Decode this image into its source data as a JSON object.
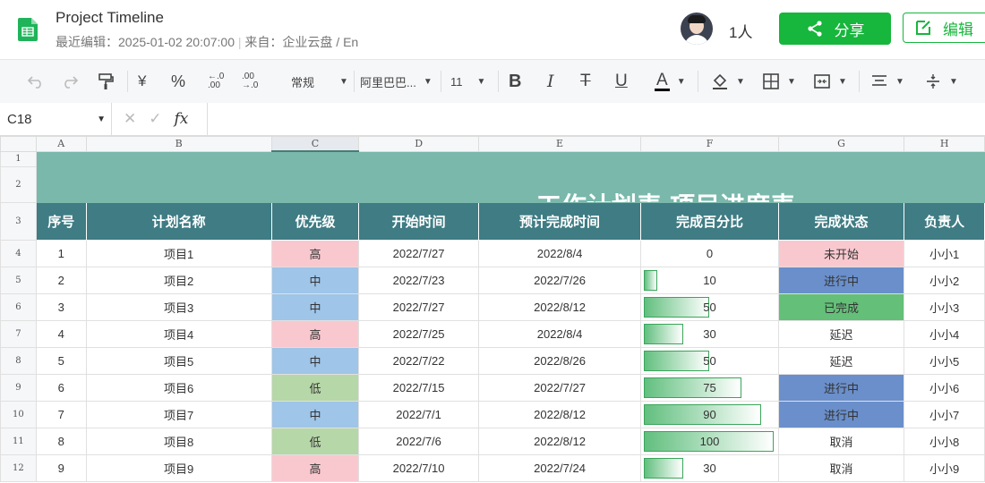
{
  "header": {
    "title": "Project Timeline",
    "meta_edited": "最近编辑：2025-01-02 20:07:00",
    "meta_source": "来自：企业云盘 / En",
    "people_count": "1人",
    "share_label": "分享",
    "edit_label": "编辑"
  },
  "toolbar": {
    "currency": "¥",
    "percent": "%",
    "dec_increase": "←.0 .00",
    "dec_decrease": ".00 →.0",
    "number_format": "常规",
    "font_family": "阿里巴巴...",
    "font_size": "11",
    "bold": "B",
    "italic": "I",
    "strike": "T",
    "underline": "U",
    "font_color": "A"
  },
  "formula_bar": {
    "cell_ref": "C18",
    "fx": "fx"
  },
  "columns": [
    "A",
    "B",
    "C",
    "D",
    "E",
    "F",
    "G",
    "H"
  ],
  "row_numbers": [
    "1",
    "2",
    "3",
    "4",
    "5",
    "6",
    "7",
    "8",
    "9",
    "10",
    "11",
    "12"
  ],
  "sheet": {
    "title": "工作计划表-项目进度表",
    "headers": [
      "序号",
      "计划名称",
      "优先级",
      "开始时间",
      "预计完成时间",
      "完成百分比",
      "完成状态",
      "负责人"
    ],
    "rows": [
      {
        "no": "1",
        "name": "项目1",
        "priority": "高",
        "priority_level": "high",
        "start": "2022/7/27",
        "end": "2022/8/4",
        "pct": "0",
        "pct_value": 0,
        "status": "未开始",
        "status_type": "notstart",
        "owner": "小小1"
      },
      {
        "no": "2",
        "name": "项目2",
        "priority": "中",
        "priority_level": "mid",
        "start": "2022/7/23",
        "end": "2022/7/26",
        "pct": "10",
        "pct_value": 10,
        "status": "进行中",
        "status_type": "progress",
        "owner": "小小2"
      },
      {
        "no": "3",
        "name": "项目3",
        "priority": "中",
        "priority_level": "mid",
        "start": "2022/7/27",
        "end": "2022/8/12",
        "pct": "50",
        "pct_value": 50,
        "status": "已完成",
        "status_type": "done",
        "owner": "小小3"
      },
      {
        "no": "4",
        "name": "项目4",
        "priority": "高",
        "priority_level": "high",
        "start": "2022/7/25",
        "end": "2022/8/4",
        "pct": "30",
        "pct_value": 30,
        "status": "延迟",
        "status_type": "none",
        "owner": "小小4"
      },
      {
        "no": "5",
        "name": "项目5",
        "priority": "中",
        "priority_level": "mid",
        "start": "2022/7/22",
        "end": "2022/8/26",
        "pct": "50",
        "pct_value": 50,
        "status": "延迟",
        "status_type": "none",
        "owner": "小小5"
      },
      {
        "no": "6",
        "name": "项目6",
        "priority": "低",
        "priority_level": "low",
        "start": "2022/7/15",
        "end": "2022/7/27",
        "pct": "75",
        "pct_value": 75,
        "status": "进行中",
        "status_type": "progress",
        "owner": "小小6"
      },
      {
        "no": "7",
        "name": "项目7",
        "priority": "中",
        "priority_level": "mid",
        "start": "2022/7/1",
        "end": "2022/8/12",
        "pct": "90",
        "pct_value": 90,
        "status": "进行中",
        "status_type": "progress",
        "owner": "小小7"
      },
      {
        "no": "8",
        "name": "项目8",
        "priority": "低",
        "priority_level": "low",
        "start": "2022/7/6",
        "end": "2022/8/12",
        "pct": "100",
        "pct_value": 100,
        "status": "取消",
        "status_type": "none",
        "owner": "小小8"
      },
      {
        "no": "9",
        "name": "项目9",
        "priority": "高",
        "priority_level": "high",
        "start": "2022/7/10",
        "end": "2022/7/24",
        "pct": "30",
        "pct_value": 30,
        "status": "取消",
        "status_type": "none",
        "owner": "小小9"
      }
    ]
  }
}
